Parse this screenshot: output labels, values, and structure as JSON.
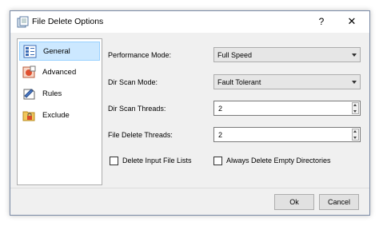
{
  "window": {
    "title": "File Delete Options",
    "help_label": "?",
    "close_label": "✕"
  },
  "sidebar": {
    "items": [
      {
        "label": "General",
        "icon": "general-settings-icon",
        "selected": true
      },
      {
        "label": "Advanced",
        "icon": "advanced-settings-icon",
        "selected": false
      },
      {
        "label": "Rules",
        "icon": "rules-icon",
        "selected": false
      },
      {
        "label": "Exclude",
        "icon": "exclude-lock-icon",
        "selected": false
      }
    ]
  },
  "form": {
    "performance_mode": {
      "label": "Performance Mode:",
      "value": "Full Speed"
    },
    "dir_scan_mode": {
      "label": "Dir Scan Mode:",
      "value": "Fault Tolerant"
    },
    "dir_scan_threads": {
      "label": "Dir Scan Threads:",
      "value": "2"
    },
    "file_delete_threads": {
      "label": "File Delete Threads:",
      "value": "2"
    },
    "delete_input_file_lists": {
      "label": "Delete Input File Lists",
      "checked": false
    },
    "always_delete_empty_dirs": {
      "label": "Always Delete Empty Directories",
      "checked": false
    }
  },
  "footer": {
    "ok_label": "Ok",
    "cancel_label": "Cancel"
  },
  "colors": {
    "selected_bg": "#cce8ff",
    "dialog_bg": "#f0f0f0"
  }
}
